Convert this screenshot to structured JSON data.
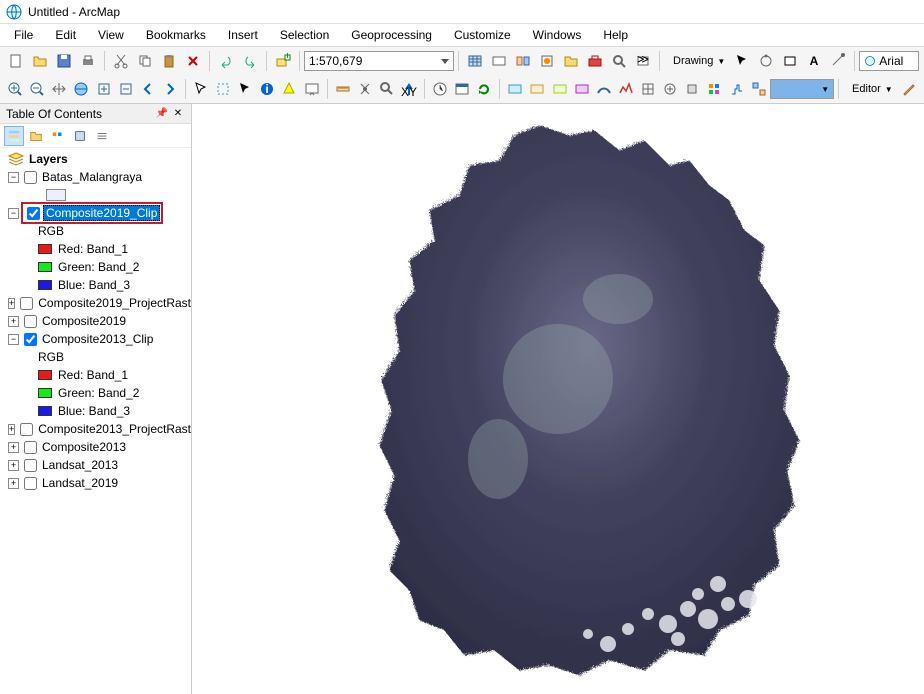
{
  "window": {
    "title": "Untitled - ArcMap"
  },
  "menu": {
    "items": [
      "File",
      "Edit",
      "View",
      "Bookmarks",
      "Insert",
      "Selection",
      "Geoprocessing",
      "Customize",
      "Windows",
      "Help"
    ]
  },
  "toolbar1": {
    "scale": "1:570,679",
    "drawing_label": "Drawing",
    "font": "Arial"
  },
  "toolbar2": {
    "value_box": "",
    "editor_label": "Editor"
  },
  "toc": {
    "title": "Table Of Contents",
    "root": "Layers",
    "nodes": {
      "batas": "Batas_Malangraya",
      "comp2019clip": "Composite2019_Clip",
      "rgb_label": "RGB",
      "red": "Red:   Band_1",
      "green": "Green: Band_2",
      "blue": "Blue:   Band_3",
      "comp2019proj": "Composite2019_ProjectRast",
      "comp2019": "Composite2019",
      "comp2013clip": "Composite2013_Clip",
      "comp2013proj": "Composite2013_ProjectRast",
      "comp2013": "Composite2013",
      "landsat2013": "Landsat_2013",
      "landsat2019": "Landsat_2019"
    }
  },
  "icons": {
    "globe": "globe-icon"
  }
}
